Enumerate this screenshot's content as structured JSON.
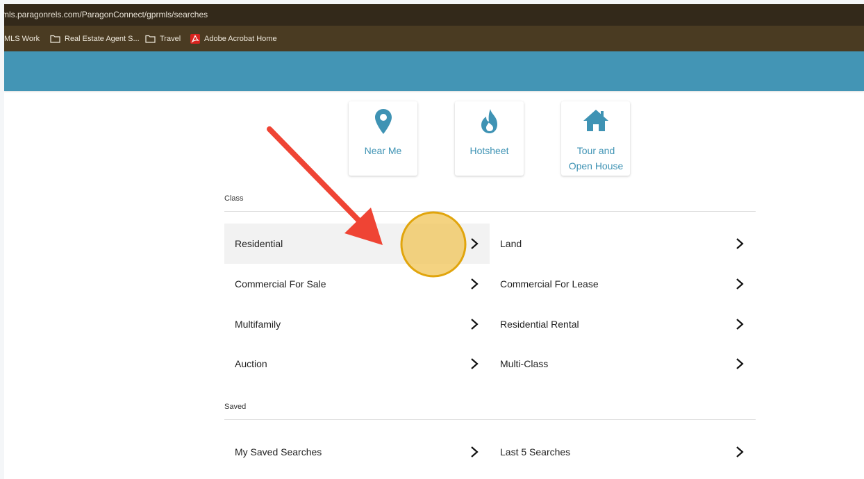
{
  "browser": {
    "url": "mls.paragonrels.com/ParagonConnect/gprmls/searches",
    "bookmarks": [
      {
        "label": "MLS Work",
        "icon": "none"
      },
      {
        "label": "Real Estate Agent S...",
        "icon": "folder-icon"
      },
      {
        "label": "Travel",
        "icon": "folder-icon"
      },
      {
        "label": "Adobe Acrobat Home",
        "icon": "acrobat-icon"
      }
    ]
  },
  "quick_tiles": [
    {
      "label": "Near Me",
      "icon": "location-pin-icon"
    },
    {
      "label": "Hotsheet",
      "icon": "flame-icon"
    },
    {
      "label": "Tour and Open House",
      "icon": "house-icon"
    }
  ],
  "class_section": {
    "label": "Class",
    "items": [
      {
        "label": "Residential"
      },
      {
        "label": "Land"
      },
      {
        "label": "Commercial For Sale"
      },
      {
        "label": "Commercial For Lease"
      },
      {
        "label": "Multifamily"
      },
      {
        "label": "Residential Rental"
      },
      {
        "label": "Auction"
      },
      {
        "label": "Multi-Class"
      }
    ]
  },
  "saved_section": {
    "label": "Saved",
    "items": [
      {
        "label": "My Saved Searches"
      },
      {
        "label": "Last 5 Searches"
      }
    ]
  },
  "colors": {
    "app_bar": "#4395b5",
    "accent": "#3f93b4",
    "annotation_arrow": "#ef4434",
    "annotation_circle": "#f0c250"
  }
}
